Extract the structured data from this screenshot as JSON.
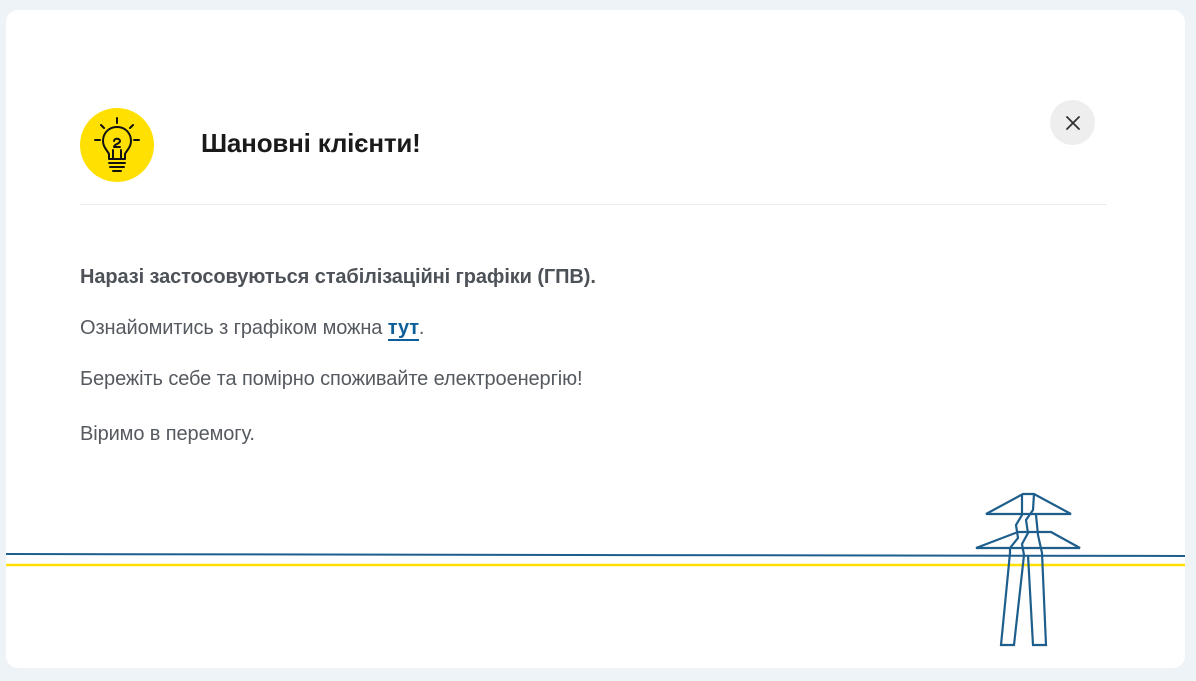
{
  "modal": {
    "title": "Шановні клієнти!",
    "icon": "lightbulb-icon",
    "close_icon": "close-icon",
    "paragraphs": {
      "p1": "Наразі застосовуються стабілізаційні графіки (ГПВ).",
      "p2_before": "Ознайомитись з графіком можна ",
      "p2_link": "тут",
      "p2_after": ".",
      "p3": "Бережіть себе та помірно споживайте електроенергію!",
      "p4": "Віримо в перемогу."
    },
    "illustration": "power-line-tower-icon"
  },
  "colors": {
    "accent_yellow": "#ffe000",
    "accent_blue": "#1d5e8c",
    "link": "#0c5f99",
    "background": "#eef3f8"
  }
}
